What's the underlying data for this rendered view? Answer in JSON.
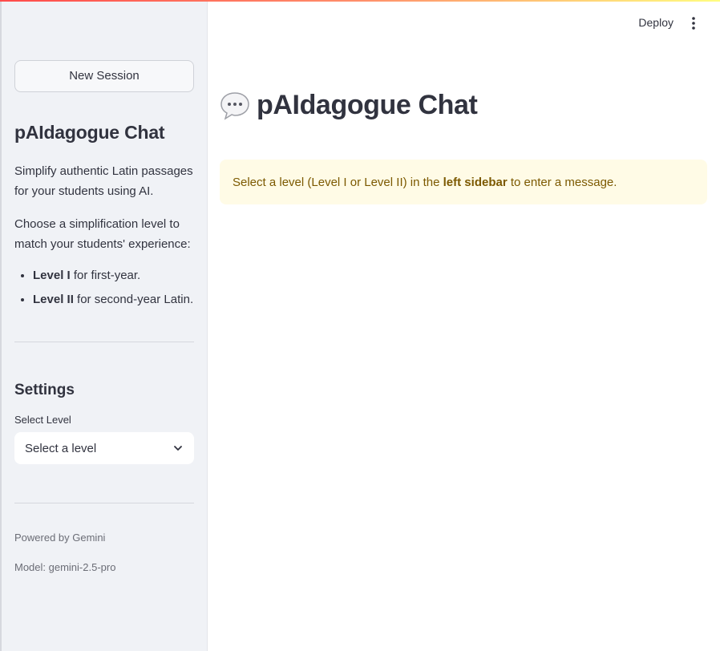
{
  "sidebar": {
    "new_session_label": "New Session",
    "title": "pAIdagogue Chat",
    "intro": "Simplify authentic Latin passages for your students using AI.",
    "choose_text": "Choose a simplification level to match your students' experience:",
    "levels": [
      {
        "name": "Level I",
        "desc": " for first-year."
      },
      {
        "name": "Level II",
        "desc": " for second-year Latin."
      }
    ],
    "settings_heading": "Settings",
    "select_label": "Select Level",
    "select_value": "Select a level",
    "powered_by": "Powered by Gemini",
    "model": "Model: gemini-2.5-pro"
  },
  "header": {
    "deploy_label": "Deploy",
    "menu_icon": "kebab-menu-icon"
  },
  "main": {
    "chat_icon": "speech-bubble-icon",
    "title": "pAIdagogue Chat",
    "alert": {
      "before": "Select a level (Level I or Level II) in the ",
      "bold": "left sidebar",
      "after": " to enter a message."
    }
  },
  "colors": {
    "sidebar_bg": "#f0f2f6",
    "text": "#31333f",
    "alert_bg": "#fffbe6",
    "alert_text": "#7c5900",
    "accent_gradient_start": "#ff4b4b",
    "accent_gradient_end": "#fffd80"
  }
}
